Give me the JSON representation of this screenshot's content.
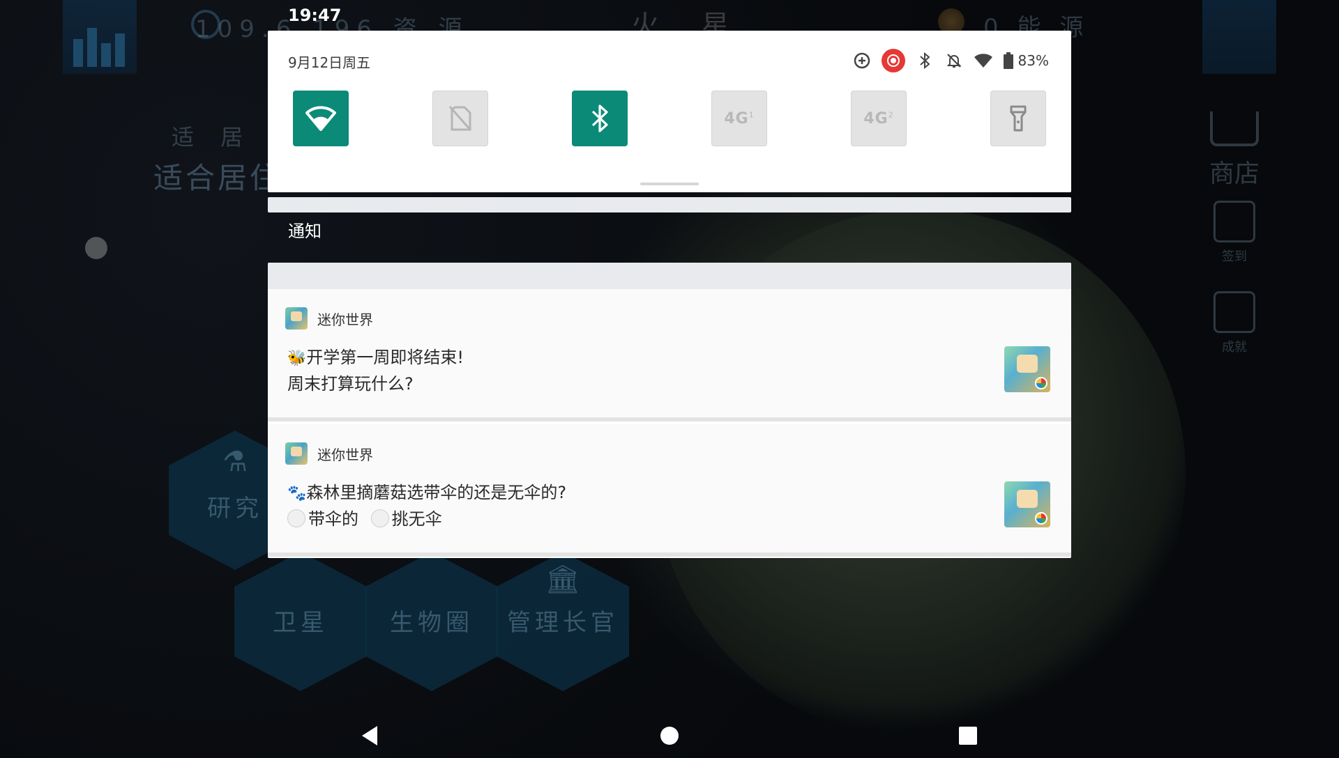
{
  "status_bar": {
    "time": "19:47"
  },
  "background_game": {
    "resource_text": "109.6.196 资 源",
    "planet_name": "火 星",
    "energy_text": "0 能 源",
    "habitability_label": "适 居 性",
    "habitability_value": "适合居住",
    "side_menu": {
      "shop": "商店",
      "checkin": "签到",
      "achievement": "成就"
    },
    "hex_menu": {
      "research": "研究",
      "satellite": "卫星",
      "biosphere": "生物圈",
      "governor": "管理长官"
    }
  },
  "quick_settings": {
    "date": "9月12日周五",
    "battery_percent": "83%",
    "status_icons": [
      "data-saver-icon",
      "screen-record-icon",
      "bluetooth-icon",
      "do-not-disturb-icon",
      "wifi-icon",
      "battery-icon"
    ],
    "tiles": [
      {
        "name": "wifi",
        "state": "on"
      },
      {
        "name": "no-sim",
        "state": "off"
      },
      {
        "name": "bluetooth",
        "state": "on"
      },
      {
        "name": "4g-sim1",
        "state": "off",
        "label": "4G",
        "sup": "1"
      },
      {
        "name": "4g-sim2",
        "state": "off",
        "label": "4G",
        "sup": "2"
      },
      {
        "name": "flashlight",
        "state": "off"
      }
    ],
    "accent_color": "#0b8a78"
  },
  "notifications_header": "通知",
  "notifications": [
    {
      "app_name": "迷你世界",
      "emoji": "🐝",
      "line1": "开学第一周即将结束!",
      "line2": "周末打算玩什么?"
    },
    {
      "app_name": "迷你世界",
      "emoji": "🐾",
      "line1": "森林里摘蘑菇选带伞的还是无伞的?",
      "option1": "带伞的",
      "option2": "挑无伞"
    }
  ]
}
